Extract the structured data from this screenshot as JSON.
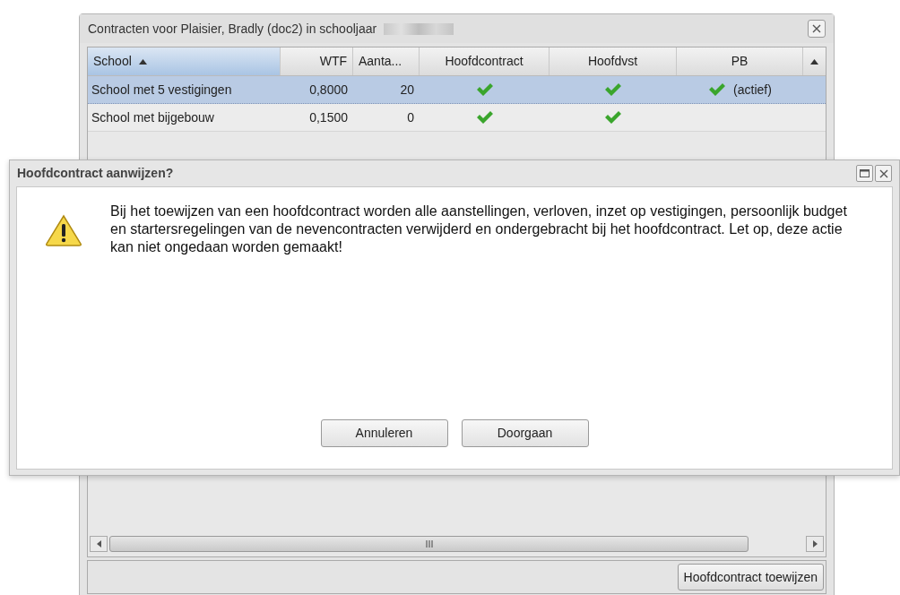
{
  "window": {
    "title": "Contracten voor Plaisier, Bradly (doc2) in schooljaar",
    "title_redacted": true
  },
  "table": {
    "columns": [
      {
        "label": "School",
        "sorted": true
      },
      {
        "label": "WTF",
        "sorted": false
      },
      {
        "label": "Aanta...",
        "sorted": false
      },
      {
        "label": "Hoofdcontract",
        "sorted": false
      },
      {
        "label": "Hoofdvst",
        "sorted": false
      },
      {
        "label": "PB",
        "sorted": false
      }
    ],
    "rows": [
      {
        "school": "School met 5 vestigingen",
        "wtf": "0,8000",
        "aantal": "20",
        "hoofdcontract": true,
        "hoofdvst": true,
        "pb": true,
        "pb_note": "(actief)",
        "selected": true
      },
      {
        "school": "School met bijgebouw",
        "wtf": "0,1500",
        "aantal": "0",
        "hoofdcontract": true,
        "hoofdvst": true,
        "pb": false,
        "selected": false
      }
    ]
  },
  "footer_button": "Hoofdcontract toewijzen",
  "dialog": {
    "title": "Hoofdcontract aanwijzen?",
    "message": "Bij het toewijzen van een hoofdcontract worden alle aanstellingen, verloven, inzet op vestigingen, persoonlijk budget en startersregelingen van de nevencontracten verwijderd en ondergebracht bij het hoofdcontract. Let op, deze actie kan niet ongedaan worden gemaakt!",
    "buttons": [
      "Annuleren",
      "Doorgaan"
    ]
  }
}
